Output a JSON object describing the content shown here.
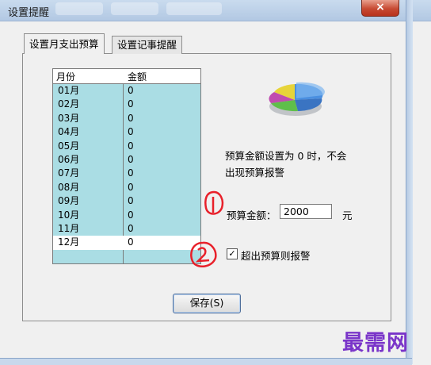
{
  "window": {
    "title": "设置提醒",
    "close_label": "×"
  },
  "tabs": [
    {
      "label": "设置月支出预算"
    },
    {
      "label": "设置记事提醒"
    }
  ],
  "table": {
    "headers": [
      "月份",
      "金额"
    ],
    "rows": [
      {
        "month": "01月",
        "amount": "0"
      },
      {
        "month": "02月",
        "amount": "0"
      },
      {
        "month": "03月",
        "amount": "0"
      },
      {
        "month": "04月",
        "amount": "0"
      },
      {
        "month": "05月",
        "amount": "0"
      },
      {
        "month": "06月",
        "amount": "0"
      },
      {
        "month": "07月",
        "amount": "0"
      },
      {
        "month": "08月",
        "amount": "0"
      },
      {
        "month": "09月",
        "amount": "0"
      },
      {
        "month": "10月",
        "amount": "0"
      },
      {
        "month": "11月",
        "amount": "0"
      },
      {
        "month": "12月",
        "amount": "0"
      }
    ]
  },
  "hint": {
    "line1": "预算金额设置为 0 时，不会",
    "line2": "出现预算报警"
  },
  "budget": {
    "label": "预算金额：",
    "value": "2000",
    "unit": "元"
  },
  "alarm": {
    "label": "超出预算则报警",
    "checked": true
  },
  "save": {
    "label": "保存(S)"
  },
  "annotations": {
    "one": "1",
    "two": "2",
    "color": "#e8202a"
  },
  "watermark": "最需网",
  "colors": {
    "table_bg": "#aadde4",
    "title_bar": "#b2c8e3",
    "close": "#c74a33",
    "watermark": "#7a35c9"
  }
}
